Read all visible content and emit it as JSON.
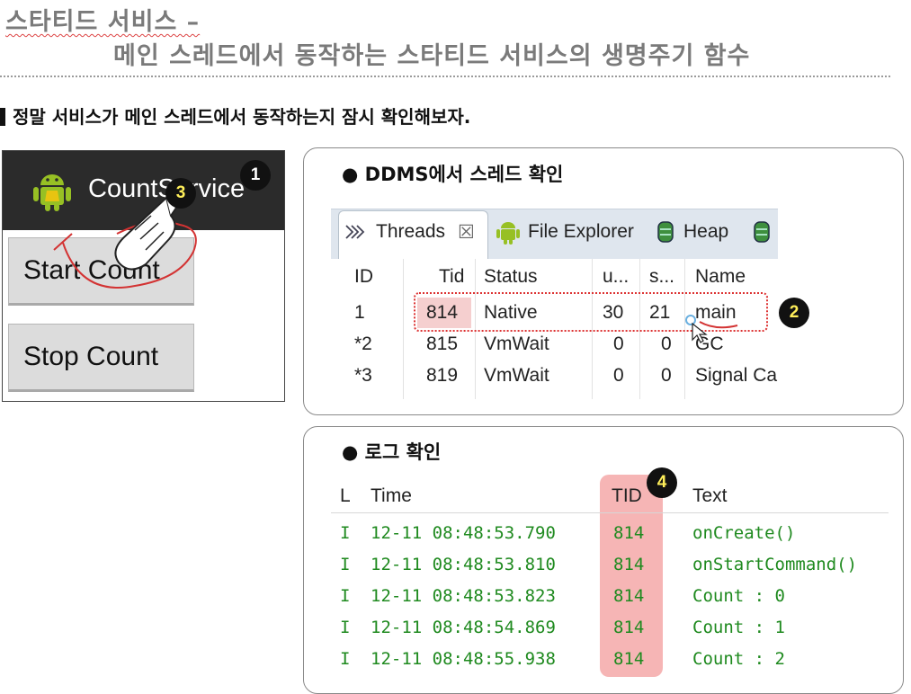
{
  "header": {
    "title_line1": "스타티드 서비스 –",
    "title_line2": "메인 스레드에서 동작하는 스타티드 서비스의 생명주기 함수",
    "subtitle": "정말 서비스가 메인 스레드에서 동작하는지 잠시 확인해보자."
  },
  "phone": {
    "app_title": "CountService",
    "start_button": "Start Count",
    "stop_button": "Stop Count",
    "badge1": "1",
    "badge3": "3"
  },
  "ddms": {
    "heading": "● DDMS에서 스레드 확인",
    "tabs": [
      "Threads",
      "File Explorer",
      "Heap"
    ],
    "tab_close": "☒",
    "columns": [
      "ID",
      "Tid",
      "Status",
      "u...",
      "s...",
      "Name"
    ],
    "rows": [
      [
        "1",
        "814",
        "Native",
        "30",
        "21",
        "main"
      ],
      [
        "*2",
        "815",
        "VmWait",
        "0",
        "0",
        "GC"
      ],
      [
        "*3",
        "819",
        "VmWait",
        "0",
        "0",
        "Signal Ca"
      ]
    ],
    "badge2": "2"
  },
  "log": {
    "heading": "● 로그 확인",
    "columns": [
      "L",
      "Time",
      "TID",
      "Text"
    ],
    "rows": [
      [
        "I",
        "12-11 08:48:53.790",
        "814",
        "onCreate()"
      ],
      [
        "I",
        "12-11 08:48:53.810",
        "814",
        "onStartCommand()"
      ],
      [
        "I",
        "12-11 08:48:53.823",
        "814",
        "Count : 0"
      ],
      [
        "I",
        "12-11 08:48:54.869",
        "814",
        "Count : 1"
      ],
      [
        "I",
        "12-11 08:48:55.938",
        "814",
        "Count : 2"
      ]
    ],
    "badge4": "4"
  },
  "colors": {
    "log_text": "#1f8a1f",
    "tid_highlight": "#f4a8a8",
    "annotation_red": "#d33333"
  }
}
